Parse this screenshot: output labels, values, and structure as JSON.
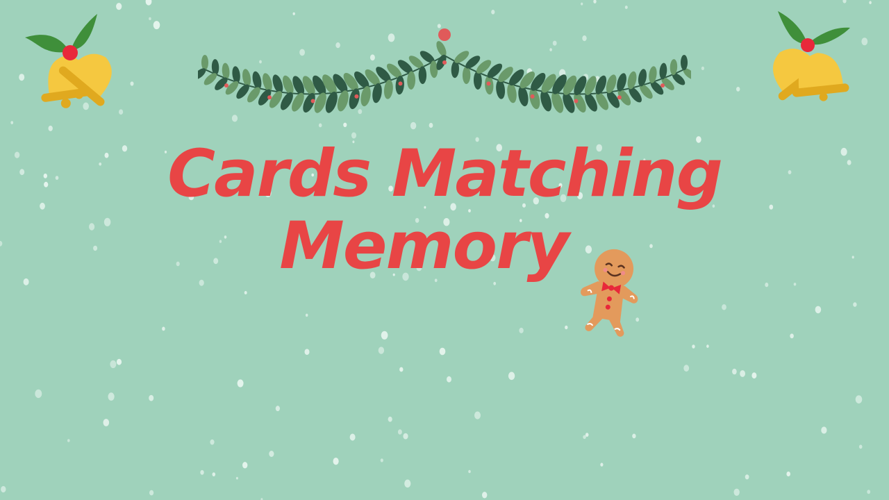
{
  "game": {
    "title_line_1": "Cards Matching",
    "title_line_2": "Memory"
  },
  "colors": {
    "background": "#9fd2bb",
    "title": "#e84545",
    "snow": "#e8f5ef",
    "leaf_dark": "#2f5a45",
    "leaf_light": "#6a9a6a",
    "berry": "#e05a5a",
    "bell": "#f5c840",
    "bell_shade": "#e0a91f",
    "holly": "#3f8f3a",
    "holly_berry": "#e8283a",
    "gingerbread": "#e39a5c",
    "gingerbread_bow": "#e8283a"
  },
  "decorations": {
    "top_left": "bells-with-holly-icon",
    "top_right": "bells-with-holly-icon",
    "top_center": "garland-icon",
    "title_side": "gingerbread-man-icon",
    "background": "snowfall"
  }
}
